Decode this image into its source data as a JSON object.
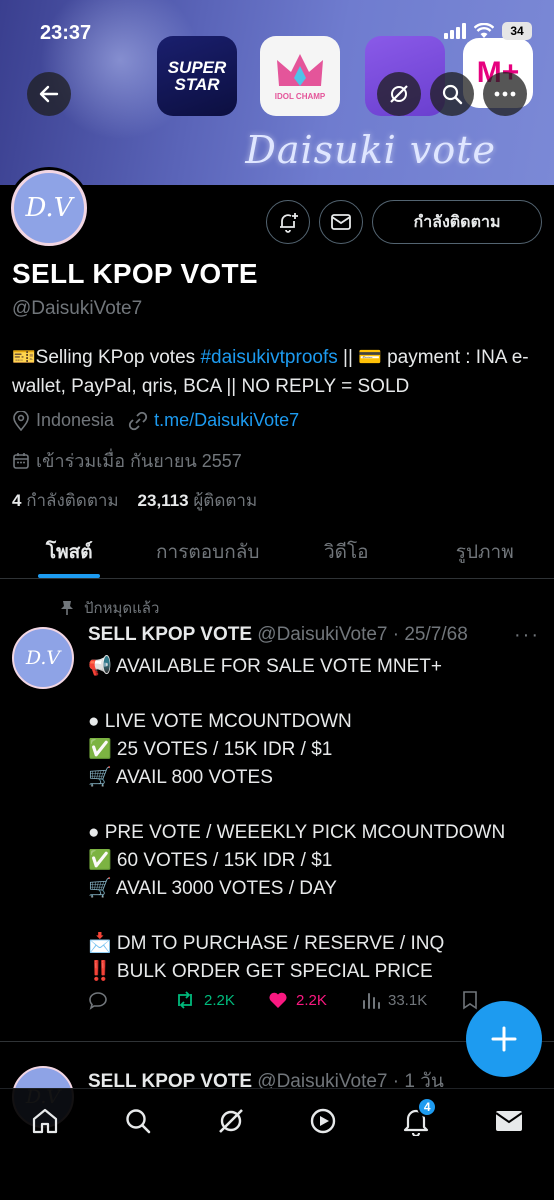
{
  "status_bar": {
    "time": "23:37",
    "battery": "34"
  },
  "banner": {
    "text": "Daisuki vote",
    "apps": {
      "superstar": "SUPER STAR",
      "idolchamp": "IDOL CHAMP",
      "mnet": "M+"
    }
  },
  "profile": {
    "avatar_initials": "D.V",
    "follow_button": "กำลังติดตาม",
    "display_name": "SELL KPOP VOTE",
    "handle": "@DaisukiVote7",
    "bio_part1": "🎫Selling KPop votes ",
    "bio_hashtag": "#daisukivtproofs",
    "bio_part2": " || 💳 payment : INA e-wallet, PayPal, qris, BCA || NO REPLY = SOLD",
    "location": "Indonesia",
    "link": "t.me/DaisukiVote7",
    "joined": "เข้าร่วมเมื่อ กันยายน 2557",
    "following_count": "4",
    "following_label": "กำลังติดตาม",
    "followers_count": "23,113",
    "followers_label": "ผู้ติดตาม"
  },
  "tabs": [
    "โพสต์",
    "การตอบกลับ",
    "วิดีโอ",
    "รูปภาพ"
  ],
  "pinned_label": "ปักหมุดแล้ว",
  "tweet": {
    "name": "SELL KPOP VOTE",
    "handle_time": " @DaisukiVote7 · 25/7/68",
    "body": "📢 AVAILABLE FOR SALE VOTE MNET+\n\n● LIVE VOTE MCOUNTDOWN\n✅ 25 VOTES / 15K IDR / $1\n🛒 AVAIL 800 VOTES\n\n● PRE VOTE / WEEEKLY PICK MCOUNTDOWN\n✅ 60 VOTES / 15K IDR / $1\n🛒 AVAIL 3000 VOTES / DAY\n\n📩 DM TO PURCHASE / RESERVE / INQ\n‼️ BULK ORDER GET SPECIAL PRICE",
    "reposts": "2.2K",
    "likes": "2.2K",
    "views": "33.1K"
  },
  "tweet2": {
    "name": "SELL KPOP VOTE",
    "handle_time": " @DaisukiVote7 · 1 วัน"
  },
  "nav": {
    "notifications_badge": "4"
  },
  "colors": {
    "accent": "#1d9bf0",
    "like": "#f91880",
    "repost": "#00ba7c"
  }
}
